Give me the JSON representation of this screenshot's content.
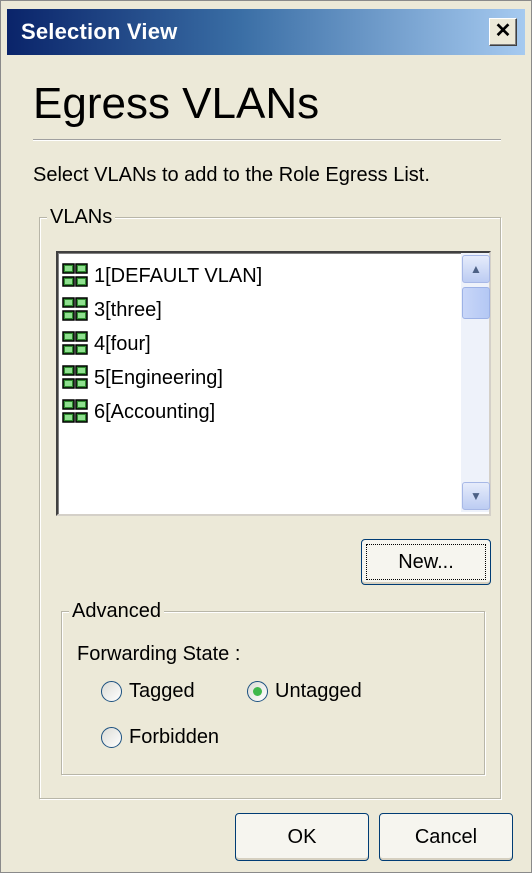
{
  "window": {
    "title": "Selection View",
    "close_glyph": "✕"
  },
  "header": {
    "heading": "Egress VLANs",
    "instructions": "Select VLANs to add to the Role Egress List."
  },
  "vlans": {
    "group_label": "VLANs",
    "items": [
      {
        "label": "1[DEFAULT VLAN]",
        "icon": "vlan-icon"
      },
      {
        "label": "3[three]",
        "icon": "vlan-icon"
      },
      {
        "label": "4[four]",
        "icon": "vlan-icon"
      },
      {
        "label": "5[Engineering]",
        "icon": "vlan-icon"
      },
      {
        "label": "6[Accounting]",
        "icon": "vlan-icon"
      }
    ],
    "new_button": "New..."
  },
  "advanced": {
    "group_label": "Advanced",
    "forwarding_label": "Forwarding State :",
    "options": [
      {
        "label": "Tagged",
        "selected": false
      },
      {
        "label": "Untagged",
        "selected": true
      },
      {
        "label": "Forbidden",
        "selected": false
      }
    ]
  },
  "footer": {
    "ok": "OK",
    "cancel": "Cancel"
  },
  "colors": {
    "radio_selected": "#3fb84c",
    "title_bar": "#0a246a"
  }
}
